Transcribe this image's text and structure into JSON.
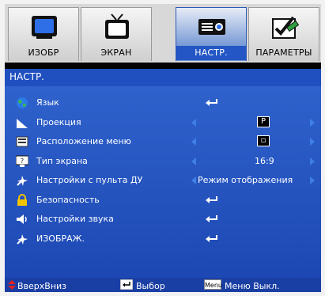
{
  "tabs": [
    {
      "label": "ИЗОБР",
      "icon": "monitor-icon",
      "active": false
    },
    {
      "label": "ЭКРАН",
      "icon": "tv-icon",
      "active": false
    },
    {
      "label": "НАСТР.",
      "icon": "projector-icon",
      "active": true
    },
    {
      "label": "ПАРАМЕТРЫ",
      "icon": "options-icon",
      "active": false
    }
  ],
  "section_title": "НАСТР.",
  "items": [
    {
      "label": "Язык",
      "icon": "globe-icon",
      "control": "enter"
    },
    {
      "label": "Проекция",
      "icon": "projection-icon",
      "control": "select",
      "value": "P"
    },
    {
      "label": "Расположение меню",
      "icon": "menu-location-icon",
      "control": "select",
      "value": "▫"
    },
    {
      "label": "Тип экрана",
      "icon": "screen-type-icon",
      "control": "select",
      "value": "16:9"
    },
    {
      "label": "Настройки с пульта ДУ",
      "icon": "remote-settings-icon",
      "control": "select",
      "value": "Режим отображения"
    },
    {
      "label": "Безопасность",
      "icon": "lock-icon",
      "control": "enter"
    },
    {
      "label": "Настройки звука",
      "icon": "speaker-icon",
      "control": "enter"
    },
    {
      "label": "ИЗОБРАЖ.",
      "icon": "image-settings-icon",
      "control": "enter"
    }
  ],
  "footer": {
    "nav_label": "ВверхВниз",
    "select_label": "Выбор",
    "menu_key": "Menu",
    "exit_label": "Меню Выкл."
  },
  "colors": {
    "accent": "#2050c0",
    "arrow": "#3f7fe6",
    "panel": "#2a5bc8"
  }
}
